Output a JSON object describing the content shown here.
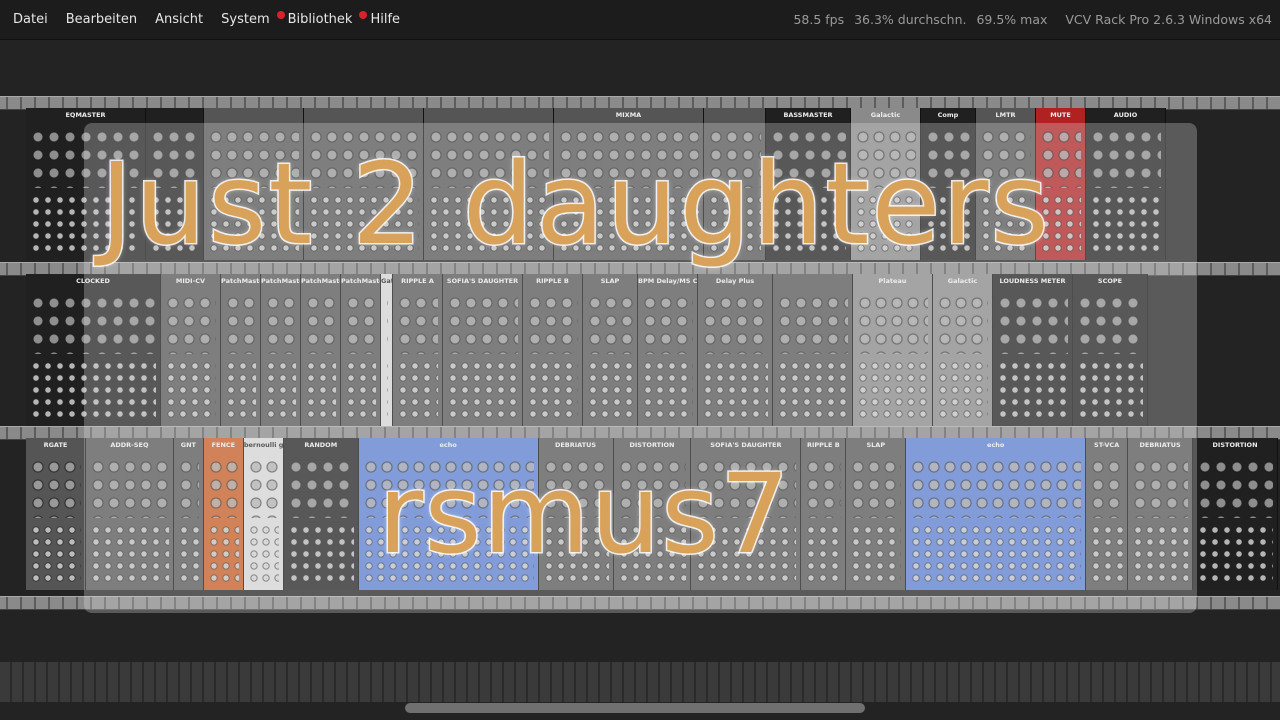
{
  "menu": {
    "items": [
      {
        "label": "Datei",
        "notify": false
      },
      {
        "label": "Bearbeiten",
        "notify": false
      },
      {
        "label": "Ansicht",
        "notify": false
      },
      {
        "label": "System",
        "notify": false
      },
      {
        "label": "Bibliothek",
        "notify": true
      },
      {
        "label": "Hilfe",
        "notify": true
      }
    ]
  },
  "status": {
    "fps": "58.5 fps",
    "avg": "36.3% durchschn.",
    "max": "69.5% max",
    "version": "VCV Rack Pro 2.6.3 Windows x64"
  },
  "rack": {
    "row1": [
      {
        "name": "EQMASTER",
        "style": "dark"
      },
      {
        "name": "",
        "style": "dark"
      },
      {
        "name": "",
        "style": "mid"
      },
      {
        "name": "",
        "style": "mid"
      },
      {
        "name": "",
        "style": "mid"
      },
      {
        "name": "MIXMA",
        "style": "mid"
      },
      {
        "name": "",
        "style": "mid"
      },
      {
        "name": "BASSMASTER",
        "style": "dark"
      },
      {
        "name": "Galactic",
        "style": "light"
      },
      {
        "name": "Comp",
        "style": "dark"
      },
      {
        "name": "LMTR",
        "style": "mid"
      },
      {
        "name": "MUTE",
        "style": "red"
      },
      {
        "name": "AUDIO",
        "style": "dark"
      }
    ],
    "row2": [
      {
        "name": "CLOCKED",
        "style": "dark"
      },
      {
        "name": "MIDI-CV",
        "style": "mid"
      },
      {
        "name": "PatchMaster",
        "style": "mid"
      },
      {
        "name": "PatchMaster",
        "style": "mid"
      },
      {
        "name": "PatchMaster",
        "style": "mid"
      },
      {
        "name": "PatchMaster",
        "style": "mid"
      },
      {
        "name": "Gat",
        "style": "white"
      },
      {
        "name": "RIPPLE A",
        "style": "mid"
      },
      {
        "name": "SOFIA'S DAUGHTER",
        "style": "mid"
      },
      {
        "name": "RIPPLE B",
        "style": "mid"
      },
      {
        "name": "SLAP",
        "style": "mid"
      },
      {
        "name": "BPM Delay/MS Calc",
        "style": "mid"
      },
      {
        "name": "Delay Plus",
        "style": "mid"
      },
      {
        "name": "",
        "style": "mid"
      },
      {
        "name": "Plateau",
        "style": "light"
      },
      {
        "name": "Galactic",
        "style": "light"
      },
      {
        "name": "LOUDNESS METER",
        "style": "dark"
      },
      {
        "name": "SCOPE",
        "style": "dark"
      }
    ],
    "row3": [
      {
        "name": "RGATE",
        "style": "mid"
      },
      {
        "name": "ADDR-SEQ",
        "style": "mid"
      },
      {
        "name": "GNT",
        "style": "mid"
      },
      {
        "name": "FENCE",
        "style": "orange"
      },
      {
        "name": "bernoulli gate",
        "style": "white"
      },
      {
        "name": "RANDOM",
        "style": "dark"
      },
      {
        "name": "echo",
        "style": "blue"
      },
      {
        "name": "DEBRIATUS",
        "style": "mid"
      },
      {
        "name": "DISTORTION",
        "style": "mid"
      },
      {
        "name": "SOFIA'S DAUGHTER",
        "style": "mid"
      },
      {
        "name": "RIPPLE B",
        "style": "mid"
      },
      {
        "name": "SLAP",
        "style": "mid"
      },
      {
        "name": "echo",
        "style": "blue"
      },
      {
        "name": "ST-VCA",
        "style": "mid"
      },
      {
        "name": "DEBRIATUS",
        "style": "mid"
      },
      {
        "name": "DISTORTION",
        "style": "dark"
      }
    ]
  },
  "overlay": {
    "line1": "Just 2 daughters",
    "line2": "rsmus7"
  }
}
